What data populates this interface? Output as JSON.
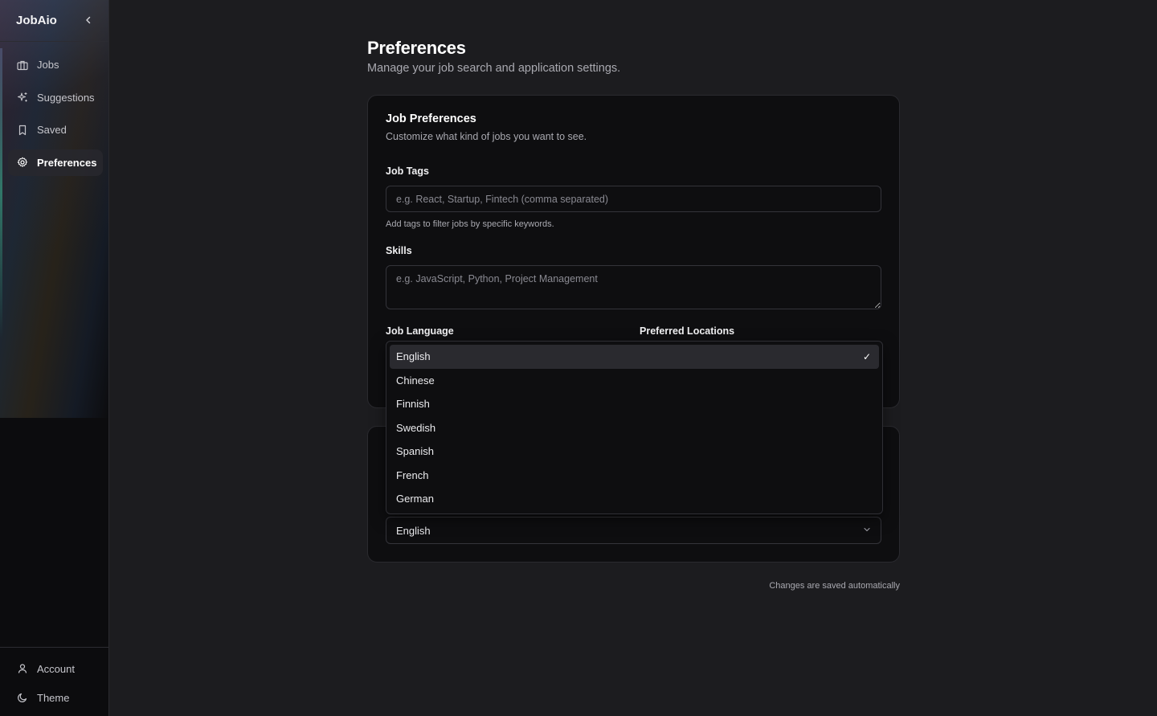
{
  "sidebar": {
    "brand": "JobAio",
    "collapse_icon": "chevron-left-icon",
    "items": [
      {
        "label": "Jobs",
        "icon": "briefcase-icon"
      },
      {
        "label": "Suggestions",
        "icon": "sparkles-icon"
      },
      {
        "label": "Saved",
        "icon": "bookmark-icon"
      },
      {
        "label": "Preferences",
        "icon": "gear-icon",
        "active": true
      }
    ],
    "footer": [
      {
        "label": "Account",
        "icon": "user-icon"
      },
      {
        "label": "Theme",
        "icon": "moon-icon"
      }
    ]
  },
  "page": {
    "title": "Preferences",
    "subtitle": "Manage your job search and application settings."
  },
  "job_preferences": {
    "title": "Job Preferences",
    "subtitle": "Customize what kind of jobs you want to see.",
    "job_tags": {
      "label": "Job Tags",
      "placeholder": "e.g. React, Startup, Fintech (comma separated)",
      "help": "Add tags to filter jobs by specific keywords."
    },
    "skills": {
      "label": "Skills",
      "placeholder": "e.g. JavaScript, Python, Project Management"
    },
    "job_language": {
      "label": "Job Language",
      "options": [
        "English",
        "Chinese",
        "Finnish",
        "Swedish",
        "Spanish",
        "French",
        "German"
      ],
      "selected": "English"
    },
    "preferred_locations": {
      "label": "Preferred Locations"
    }
  },
  "second_card": {
    "select_value": "English"
  },
  "footer_note": "Changes are saved automatically",
  "colors": {
    "background": "#1c1c1f",
    "card": "#0e0e10",
    "border": "#34343a",
    "selected_option": "#2a2a2f"
  }
}
